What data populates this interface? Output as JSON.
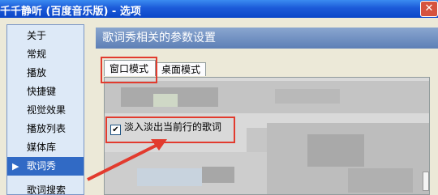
{
  "window": {
    "title": "千千静听 (百度音乐版) - 选项",
    "close_glyph": "✕"
  },
  "sidebar": {
    "items": [
      {
        "label": "关于"
      },
      {
        "label": "常规"
      },
      {
        "label": "播放"
      },
      {
        "label": "快捷键"
      },
      {
        "label": "视觉效果"
      },
      {
        "label": "播放列表"
      },
      {
        "label": "媒体库"
      },
      {
        "label": "歌词秀",
        "selected": true
      },
      {
        "label": "歌词搜索"
      }
    ],
    "selected_arrow": "▶"
  },
  "main": {
    "header": "歌词秀相关的参数设置",
    "tabs": [
      {
        "label": "窗口模式",
        "active": true
      },
      {
        "label": "桌面模式",
        "active": false
      }
    ],
    "option": {
      "label": "淡入淡出当前行的歌词",
      "checked": true,
      "check_glyph": "✔"
    }
  },
  "annotations": {
    "highlight_color": "#e23b2e"
  }
}
